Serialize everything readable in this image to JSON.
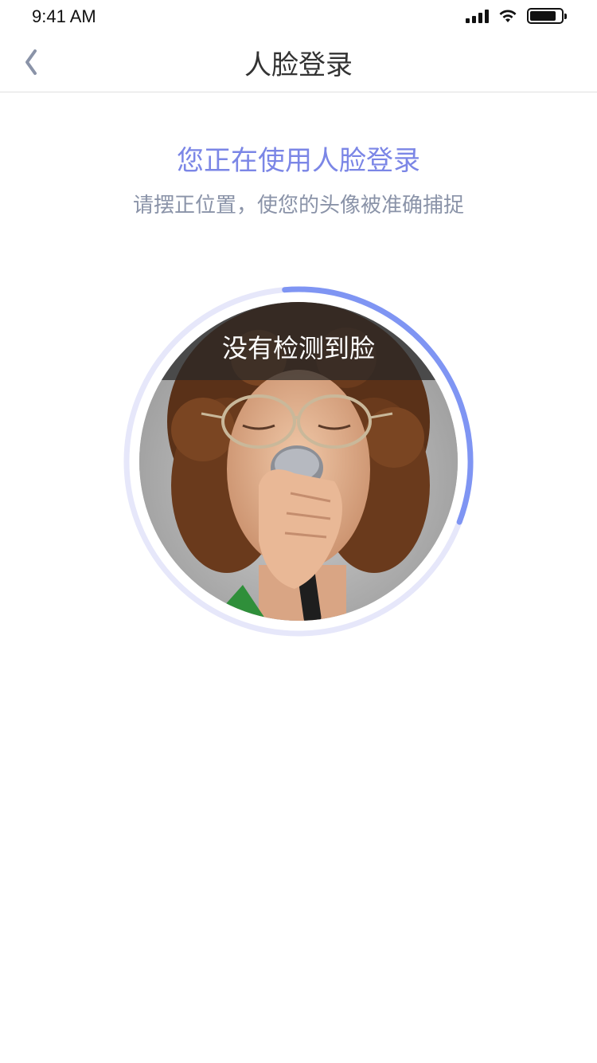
{
  "status_bar": {
    "time": "9:41 AM",
    "battery_level": 0.85,
    "icons": [
      "signal-icon",
      "wifi-icon",
      "battery-icon"
    ]
  },
  "nav": {
    "title": "人脸登录",
    "back_icon": "chevron-left-icon"
  },
  "content": {
    "headline": "您正在使用人脸登录",
    "subline": "请摆正位置，使您的头像被准确捕捉"
  },
  "face_scan": {
    "status_text": "没有检测到脸",
    "progress": 0.32,
    "photo_icon": "face-photo"
  },
  "colors": {
    "accent": "#7b86e6",
    "progress_arc": "#7f95f3",
    "ring_track": "#e6e7fa",
    "subtitle": "#8a93a8",
    "title": "#333333",
    "back_chevron": "#8a93a8"
  }
}
